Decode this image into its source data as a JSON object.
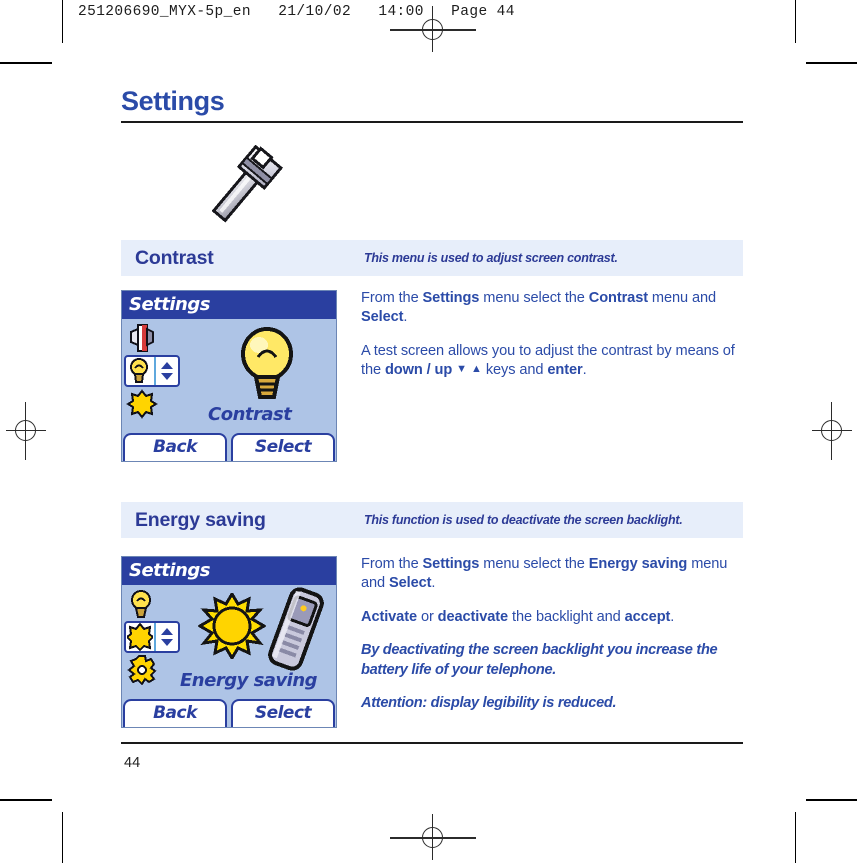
{
  "prepress": {
    "header_line": "251206690_MYX-5p_en   21/10/02   14:00   Page 44"
  },
  "page": {
    "title": "Settings",
    "folio": "44",
    "chapter_icon": "wrench-icon",
    "accent_color": "#2b4ba8",
    "header_bar_color": "#e7eefa",
    "header_text_color": "#2c3a96"
  },
  "sections": [
    {
      "id": "contrast",
      "title": "Contrast",
      "subtitle": "This menu is used to adjust screen contrast.",
      "screenshot": {
        "titlebar": "Settings",
        "caption": "Contrast",
        "softkey_left": "Back",
        "softkey_right": "Select",
        "rail_icons": [
          "contrast-icon",
          "lightbulb-icon",
          "sun-icon"
        ],
        "main_icon": "lightbulb-icon"
      },
      "body": [
        {
          "style": "normal",
          "runs": [
            {
              "t": "From the ",
              "b": false
            },
            {
              "t": "Settings",
              "b": true
            },
            {
              "t": " menu select the ",
              "b": false
            },
            {
              "t": "Contrast",
              "b": true
            },
            {
              "t": " menu and ",
              "b": false
            },
            {
              "t": "Select",
              "b": true
            },
            {
              "t": ".",
              "b": false
            }
          ]
        },
        {
          "style": "normal",
          "runs": [
            {
              "t": "A test screen allows you to adjust the contrast by means of the ",
              "b": false
            },
            {
              "t": "down / up",
              "b": true
            },
            {
              "t": " ▼  ▲ ",
              "b": false
            },
            {
              "t": " keys and ",
              "b": false
            },
            {
              "t": "enter",
              "b": true
            },
            {
              "t": ".",
              "b": false
            }
          ]
        }
      ]
    },
    {
      "id": "energy-saving",
      "title": "Energy saving",
      "subtitle": "This function is used to deactivate the screen backlight.",
      "screenshot": {
        "titlebar": "Settings",
        "caption": "Energy saving",
        "softkey_left": "Back",
        "softkey_right": "Select",
        "rail_icons": [
          "lightbulb-icon",
          "sun-icon",
          "gear-icon"
        ],
        "main_icon": "sun-and-phone-icon"
      },
      "body": [
        {
          "style": "normal",
          "runs": [
            {
              "t": "From the ",
              "b": false
            },
            {
              "t": "Settings",
              "b": true
            },
            {
              "t": " menu select the ",
              "b": false
            },
            {
              "t": "Energy saving",
              "b": true
            },
            {
              "t": " menu and ",
              "b": false
            },
            {
              "t": "Select",
              "b": true
            },
            {
              "t": ".",
              "b": false
            }
          ]
        },
        {
          "style": "normal",
          "runs": [
            {
              "t": "Activate",
              "b": true
            },
            {
              "t": " or ",
              "b": false
            },
            {
              "t": "deactivate",
              "b": true
            },
            {
              "t": " the backlight and ",
              "b": false
            },
            {
              "t": "accept",
              "b": true
            },
            {
              "t": ".",
              "b": false
            }
          ]
        },
        {
          "style": "note",
          "runs": [
            {
              "t": "By deactivating the screen backlight you increase the battery life of your telephone.",
              "b": false
            }
          ]
        },
        {
          "style": "note",
          "runs": [
            {
              "t": "Attention: display legibility is reduced.",
              "b": false
            }
          ]
        }
      ]
    }
  ]
}
